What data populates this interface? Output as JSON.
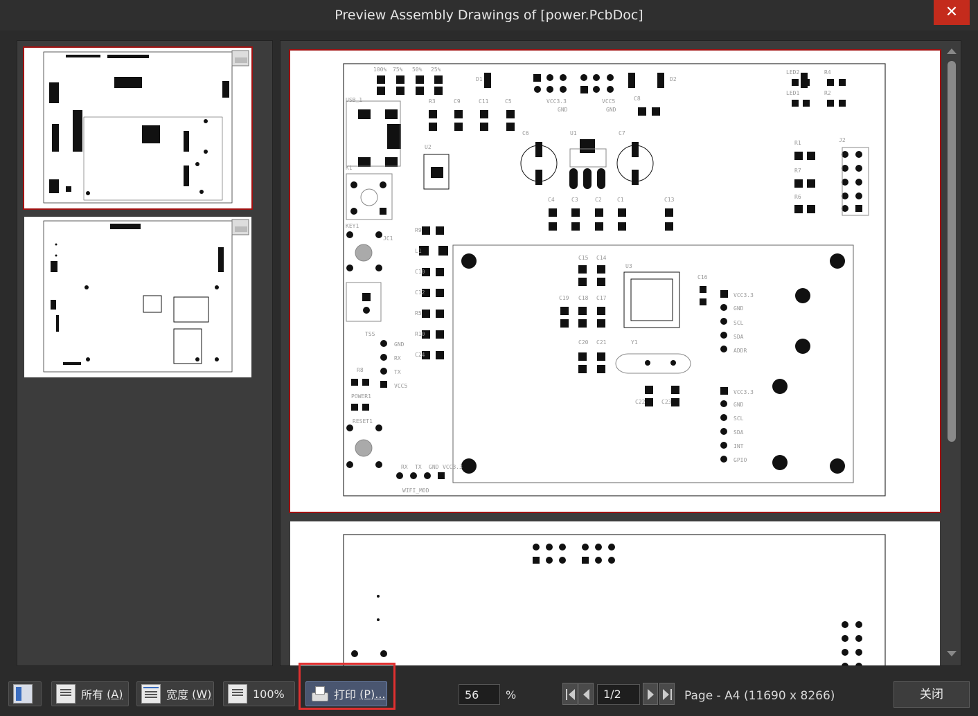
{
  "window": {
    "title": "Preview Assembly Drawings of [power.PcbDoc]"
  },
  "close_glyph": "✕",
  "toolbar": {
    "all_label": "所有",
    "all_key": "(A)",
    "width_label": "宽度",
    "width_key": "(W)",
    "zoom100_label": "100%",
    "print_label": "打印",
    "print_key": "(P)...",
    "zoom_value": "56",
    "zoom_unit": "%",
    "page_current": "1/2",
    "page_info": "Page - A4 (11690 x 8266)",
    "close_label": "关闭"
  },
  "pcb": {
    "top_labels": [
      "100%",
      "75%",
      "50%",
      "25%",
      "D1",
      "VCC3.3",
      "GND",
      "VCC5",
      "GND",
      "D2",
      "LED2",
      "LED1",
      "R4",
      "R2",
      "USB_1",
      "R3",
      "C9",
      "C11",
      "C5",
      "C8",
      "U2",
      "C6",
      "U1",
      "C7",
      "R1",
      "R7",
      "R6",
      "J2",
      "K1",
      "KEY1",
      "C4",
      "C3",
      "C2",
      "C1",
      "C13",
      "JC1",
      "R9",
      "L1",
      "C10",
      "C12",
      "R5",
      "R10",
      "C24",
      "U3",
      "C15",
      "C14",
      "C16",
      "C19",
      "C18",
      "C17",
      "C20",
      "C21",
      "Y1",
      "C22",
      "C23",
      "VCC3.3",
      "GND",
      "SCL",
      "SDA",
      "ADDR",
      "VCC3.3",
      "GND",
      "SCL",
      "SDA",
      "INT",
      "GPIO",
      "GND",
      "RX",
      "TX",
      "VCC5",
      "R8",
      "POWER1",
      "RESET1",
      "RX",
      "TX",
      "GND",
      "VCC3.3",
      "WIFI_MOD",
      "TSS"
    ]
  },
  "accent_colors": {
    "selection": "#a01010",
    "close": "#c42b1c",
    "highlight": "#e03030"
  }
}
